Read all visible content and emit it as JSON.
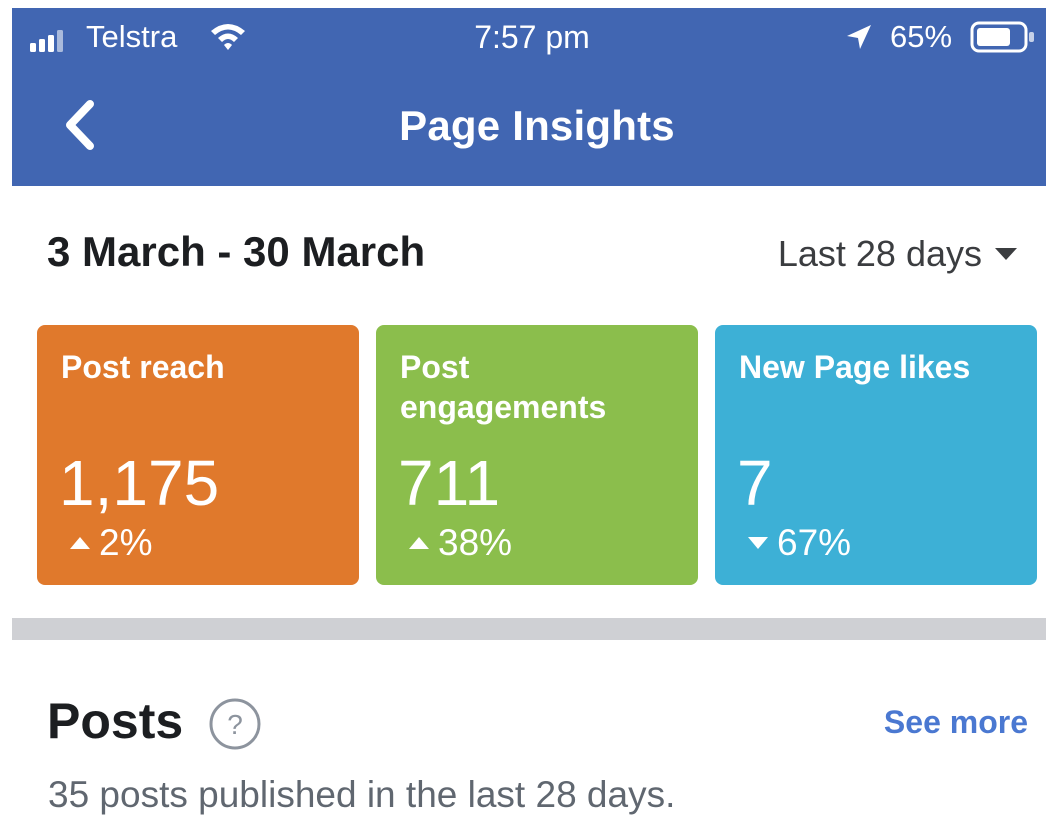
{
  "status_bar": {
    "carrier": "Telstra",
    "time": "7:57 pm",
    "battery": "65%",
    "icons": [
      "signal-icon",
      "wifi-icon",
      "location-arrow-icon",
      "battery-icon"
    ]
  },
  "header": {
    "title": "Page Insights",
    "back_icon": "chevron-left-icon",
    "background_color": "#4166b2"
  },
  "date_range": {
    "label": "3 March - 30 March",
    "selector": "Last 28 days",
    "selector_icon": "caret-down-icon"
  },
  "metrics": [
    {
      "label": "Post reach",
      "value": "1,175",
      "change": "2%",
      "direction": "up",
      "color": "#e0792c"
    },
    {
      "label": "Post engagements",
      "value": "711",
      "change": "38%",
      "direction": "up",
      "color": "#8bbe4c"
    },
    {
      "label": "New Page likes",
      "value": "7",
      "change": "67%",
      "direction": "down",
      "color": "#3db0d6"
    }
  ],
  "posts": {
    "title": "Posts",
    "help_icon": "question-circle-icon",
    "see_more": "See more",
    "summary": "35 posts published in the last 28 days.",
    "link_color": "#4a78d1"
  }
}
